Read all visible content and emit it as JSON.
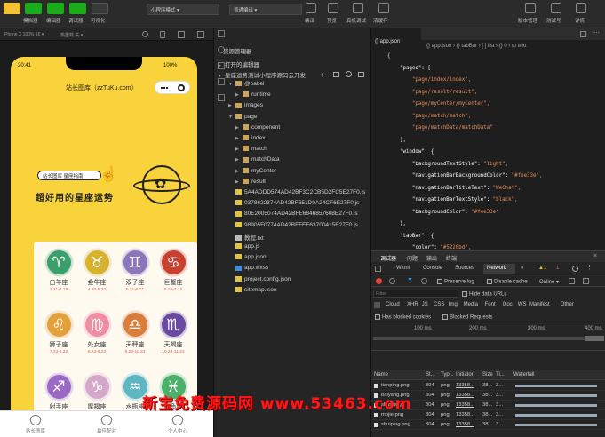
{
  "toolbar": {
    "left_buttons": [
      "模拟器",
      "编辑器",
      "调试器",
      "可视化"
    ],
    "mode_select": "小程序模式",
    "compile_select": "普通编译",
    "mid_buttons": [
      "编译",
      "预览",
      "真机调试",
      "清缓存"
    ],
    "right_buttons": [
      "版本管理",
      "测试号",
      "详情"
    ]
  },
  "simulator": {
    "device": "iPhone X 100% 16 ▾",
    "hotreload": "热重载 关 ▾"
  },
  "phone": {
    "time": "20:41",
    "battery": "100%",
    "nav_title": "站长图库（zzTuKu.com）",
    "banner_pill": "站长图库 星座指南",
    "slogan": "超好用的星座运势",
    "zodiac": [
      {
        "symbol": "♈",
        "name": "白羊座",
        "dates": "3.21-4.19",
        "color": "#3a9f6a"
      },
      {
        "symbol": "♉",
        "name": "金牛座",
        "dates": "4.20-5.20",
        "color": "#d6b22f"
      },
      {
        "symbol": "♊",
        "name": "双子座",
        "dates": "5.21-6.21",
        "color": "#8a76b8"
      },
      {
        "symbol": "♋",
        "name": "巨蟹座",
        "dates": "6.22-7.22",
        "color": "#c8402e"
      },
      {
        "symbol": "♌",
        "name": "狮子座",
        "dates": "7.23-8.22",
        "color": "#e3a13b"
      },
      {
        "symbol": "♍",
        "name": "处女座",
        "dates": "8.23-9.22",
        "color": "#f08da3"
      },
      {
        "symbol": "♎",
        "name": "天秤座",
        "dates": "9.23-10.23",
        "color": "#d97e3a"
      },
      {
        "symbol": "♏",
        "name": "天蝎座",
        "dates": "10.24-11.22",
        "color": "#6a4aa0"
      },
      {
        "symbol": "♐",
        "name": "射手座",
        "dates": "11.23-12.21",
        "color": "#9c68c5"
      },
      {
        "symbol": "♑",
        "name": "摩羯座",
        "dates": "12.22-1.19",
        "color": "#d5a8c9"
      },
      {
        "symbol": "♒",
        "name": "水瓶座",
        "dates": "1.20-2.18",
        "color": "#5db6c2"
      },
      {
        "symbol": "♓",
        "name": "双鱼座",
        "dates": "2.19-3.20",
        "color": "#4bb06a"
      }
    ],
    "tabs": [
      "站长图库",
      "最佳配对",
      "个人中心"
    ]
  },
  "explorer": {
    "title": "资源管理器",
    "open_editors": "打开的编辑器",
    "project": "星座运势测试小程序源码云开发",
    "items": [
      {
        "label": "@babel",
        "indent": 1,
        "type": "folder",
        "open": true
      },
      {
        "label": "runtime",
        "indent": 2,
        "type": "folder",
        "open": false
      },
      {
        "label": "images",
        "indent": 1,
        "type": "folder",
        "open": false
      },
      {
        "label": "page",
        "indent": 1,
        "type": "folder",
        "open": true
      },
      {
        "label": "component",
        "indent": 2,
        "type": "folder",
        "open": false
      },
      {
        "label": "index",
        "indent": 2,
        "type": "folder",
        "open": false
      },
      {
        "label": "match",
        "indent": 2,
        "type": "folder",
        "open": false
      },
      {
        "label": "matchData",
        "indent": 2,
        "type": "folder",
        "open": false
      },
      {
        "label": "myCenter",
        "indent": 2,
        "type": "folder",
        "open": false
      },
      {
        "label": "result",
        "indent": 2,
        "type": "folder",
        "open": false
      },
      {
        "label": "5A4ADDD574AD42BF3C2CB5D2FC5E27F0.js",
        "indent": 1,
        "type": "js",
        "open": false
      },
      {
        "label": "0378622374AD42BF651D0A24CF6E27F0.js",
        "indent": 1,
        "type": "js",
        "open": false
      },
      {
        "label": "80E2005074AD42BFE6846857608E27F0.js",
        "indent": 1,
        "type": "js",
        "open": false
      },
      {
        "label": "98905F0774AD42BFFEF63700415E27F0.js",
        "indent": 1,
        "type": "js",
        "open": false
      },
      {
        "label": "教程.txt",
        "indent": 1,
        "type": "txt",
        "open": false
      },
      {
        "label": "app.js",
        "indent": 1,
        "type": "js",
        "open": false
      },
      {
        "label": "app.json",
        "indent": 1,
        "type": "json",
        "open": false
      },
      {
        "label": "app.wxss",
        "indent": 1,
        "type": "wxss",
        "open": false
      },
      {
        "label": "project.config.json",
        "indent": 1,
        "type": "json",
        "open": false
      },
      {
        "label": "sitemap.json",
        "indent": 1,
        "type": "json",
        "open": false
      }
    ]
  },
  "editor": {
    "tab": "{} app.json",
    "breadcrumb": "{} app.json › {} tabBar › [ ] list › {} 0 › ⊡ text",
    "lines": [
      [
        {
          "t": "{",
          "c": "p"
        }
      ],
      [
        {
          "t": "    \"pages\": [",
          "c": "k"
        }
      ],
      [
        {
          "t": "        \"page/index/index\",",
          "c": "s"
        }
      ],
      [
        {
          "t": "        \"page/result/result\",",
          "c": "s"
        }
      ],
      [
        {
          "t": "        \"page/myCenter/myCenter\",",
          "c": "s"
        }
      ],
      [
        {
          "t": "        \"page/match/match\",",
          "c": "s"
        }
      ],
      [
        {
          "t": "        \"page/matchData/matchData\"",
          "c": "s"
        }
      ],
      [
        {
          "t": "    ],",
          "c": "p"
        }
      ],
      [
        {
          "t": "    \"window\": {",
          "c": "k"
        }
      ],
      [
        {
          "t": "        \"backgroundTextStyle\": ",
          "c": "k"
        },
        {
          "t": "\"light\",",
          "c": "s"
        }
      ],
      [
        {
          "t": "        \"navigationBarBackgroundColor\": ",
          "c": "k"
        },
        {
          "t": "\"#fee33e\",",
          "c": "s"
        }
      ],
      [
        {
          "t": "        \"navigationBarTitleText\": ",
          "c": "k"
        },
        {
          "t": "\"WeChat\",",
          "c": "s"
        }
      ],
      [
        {
          "t": "        \"navigationBarTextStyle\": ",
          "c": "k"
        },
        {
          "t": "\"black\",",
          "c": "s"
        }
      ],
      [
        {
          "t": "        \"backgroundColor\": ",
          "c": "k"
        },
        {
          "t": "\"#fee33e\"",
          "c": "s"
        }
      ],
      [
        {
          "t": "    },",
          "c": "p"
        }
      ],
      [
        {
          "t": "    \"tabBar\": {",
          "c": "k"
        }
      ],
      [
        {
          "t": "        \"color\": ",
          "c": "k"
        },
        {
          "t": "\"#5220bd\",",
          "c": "s"
        }
      ]
    ]
  },
  "devtools": {
    "top_tabs": [
      "调试器",
      "问题",
      "输出",
      "终端"
    ],
    "panel_tabs": [
      "Wxml",
      "Console",
      "Sources",
      "Network",
      "»"
    ],
    "warn_count": "▲1",
    "err_count": "1",
    "preserve_log": "Preserve log",
    "disable_cache": "Disable cache",
    "online": "Online",
    "filter_placeholder": "Filter",
    "hide_data_urls": "Hide data URLs",
    "types": [
      "Cloud",
      "XHR",
      "JS",
      "CSS",
      "Img",
      "Media",
      "Font",
      "Doc",
      "WS",
      "Manifest",
      "Other"
    ],
    "has_blocked": "Has blocked cookies",
    "blocked_requests": "Blocked Requests",
    "timeline": [
      "100 ms",
      "200 ms",
      "300 ms",
      "400 ms"
    ],
    "columns": [
      "Name",
      "St...",
      "Typ...",
      "Initiator",
      "Size",
      "Ti...",
      "Waterfall"
    ],
    "rows": [
      {
        "name": "tianping.png",
        "status": "304",
        "type": "png",
        "init": "13358...",
        "size": "38...",
        "time": "3..."
      },
      {
        "name": "baiyang.png",
        "status": "304",
        "type": "png",
        "init": "13358...",
        "size": "38...",
        "time": "3..."
      },
      {
        "name": "shizi.png",
        "status": "304",
        "type": "png",
        "init": "13358...",
        "size": "38...",
        "time": "3..."
      },
      {
        "name": "mojie.png",
        "status": "304",
        "type": "png",
        "init": "13358...",
        "size": "38...",
        "time": "3..."
      },
      {
        "name": "shuiping.png",
        "status": "304",
        "type": "png",
        "init": "13358...",
        "size": "38...",
        "time": "3..."
      }
    ]
  },
  "watermark": "新宝免费源码网  www.53463.com"
}
